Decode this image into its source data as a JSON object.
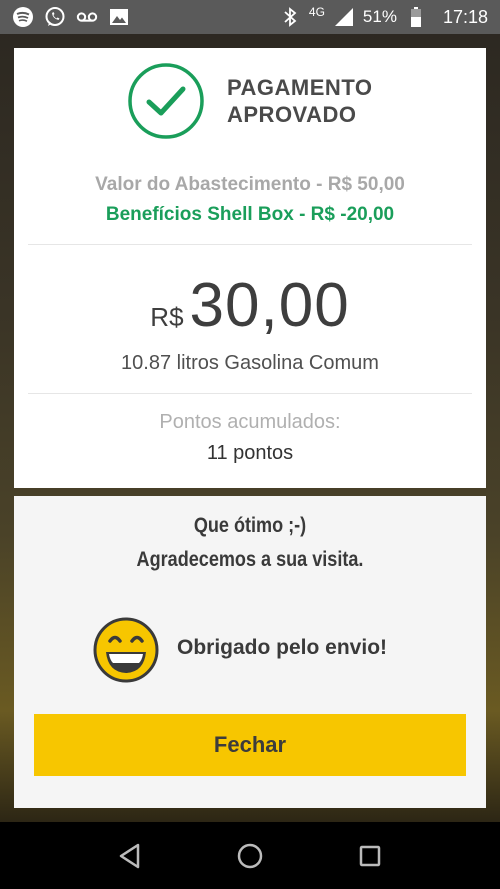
{
  "status_bar": {
    "network": "4G",
    "battery": "51%",
    "time": "17:18",
    "icons": [
      "spotify-icon",
      "whatsapp-icon",
      "voicemail-icon",
      "image-icon",
      "bluetooth-icon",
      "signal-icon",
      "battery-icon"
    ]
  },
  "receipt": {
    "status_title": "PAGAMENTO APROVADO",
    "fuel_value_line": "Valor do Abastecimento - R$ 50,00",
    "benefit_line": "Benefícios Shell Box - R$ -20,00",
    "currency": "R$",
    "amount": "30,00",
    "liters_line": "10.87 litros Gasolina Comum",
    "points_label": "Pontos acumulados:",
    "points_value": "11 pontos"
  },
  "feedback": {
    "line1": "Que ótimo ;-)",
    "line2": "Agradecemos a sua visita.",
    "sent_message": "Obrigado pelo envio!",
    "close_label": "Fechar"
  },
  "colors": {
    "approved_green": "#1a9e5a",
    "button_yellow": "#f7c600"
  }
}
